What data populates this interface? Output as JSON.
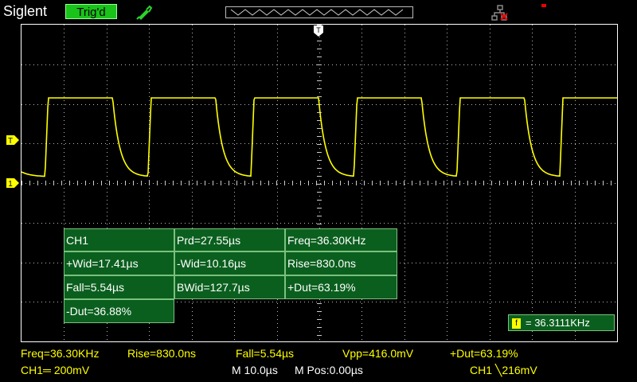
{
  "header": {
    "brand": "Siglent",
    "trigger_status": "Trig'd",
    "icons": [
      "probe-icon",
      "network-disconnected-icon"
    ]
  },
  "colors": {
    "trace": "#ffff00",
    "measurement_box": "#0b5f1e",
    "trigger_status": "#19c319"
  },
  "markers": {
    "trigger_position": "T",
    "trigger_level": "T",
    "channel1": "1"
  },
  "measurements": [
    {
      "label": "CH1"
    },
    {
      "label": "Prd=27.55µs"
    },
    {
      "label": "Freq=36.30KHz"
    },
    {
      "label": "+Wid=17.41µs"
    },
    {
      "label": "-Wid=10.16µs"
    },
    {
      "label": "Rise=830.0ns"
    },
    {
      "label": "Fall=5.54µs"
    },
    {
      "label": "BWid=127.7µs"
    },
    {
      "label": "+Dut=63.19%"
    },
    {
      "label": "-Dut=36.88%"
    }
  ],
  "frequency_counter": {
    "icon": "f",
    "value": "= 36.3111KHz"
  },
  "status_bar": {
    "freq": "Freq=36.30KHz",
    "rise": "Rise=830.0ns",
    "fall": "Fall=5.54µs",
    "vpp": "Vpp=416.0mV",
    "dut": "+Dut=63.19%",
    "ch1_scale": "CH1═ 200mV",
    "time_base": "M 10.0µs",
    "m_pos": "M Pos:0.00µs",
    "trigger": "CH1 ╲216mV"
  }
}
